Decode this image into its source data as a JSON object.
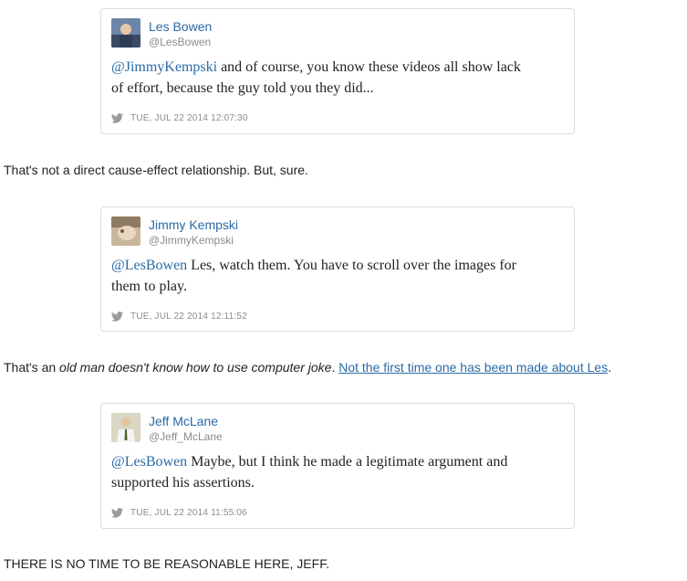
{
  "tweets": [
    {
      "name": "Les Bowen",
      "handle": "@LesBowen",
      "mention": "@JimmyKempski",
      "body_line1": " and of course, you know these videos all show lack",
      "body_line2": "of effort, because the guy told you they did...",
      "timestamp": "TUE, JUL 22 2014 12:07:30",
      "avatar_icon": "user-avatar-photo"
    },
    {
      "name": "Jimmy Kempski",
      "handle": "@JimmyKempski",
      "mention": "@LesBowen",
      "body_line1": " Les, watch them. You have to scroll over the images for",
      "body_line2": "them to play.",
      "timestamp": "TUE, JUL 22 2014 12:11:52",
      "avatar_icon": "user-avatar-photo"
    },
    {
      "name": "Jeff McLane",
      "handle": "@Jeff_McLane",
      "mention": "@LesBowen",
      "body_line1": " Maybe, but I think he made a legitimate argument and",
      "body_line2": "supported his assertions.",
      "timestamp": "TUE, JUL 22 2014 11:55:06",
      "avatar_icon": "user-avatar-photo"
    }
  ],
  "prose": {
    "p1": "That's not a direct cause-effect relationship. But, sure.",
    "p2_start": "That's an ",
    "p2_em": "old man doesn't know how to use computer joke",
    "p2_mid": ". ",
    "p2_link": "Not the first time one has been made about Les",
    "p2_end": ".",
    "p3": "THERE IS NO TIME TO BE REASONABLE HERE, JEFF."
  },
  "colors": {
    "link": "#2b6aa6",
    "meta": "#8b8b8b",
    "border": "#dcdcdc"
  }
}
